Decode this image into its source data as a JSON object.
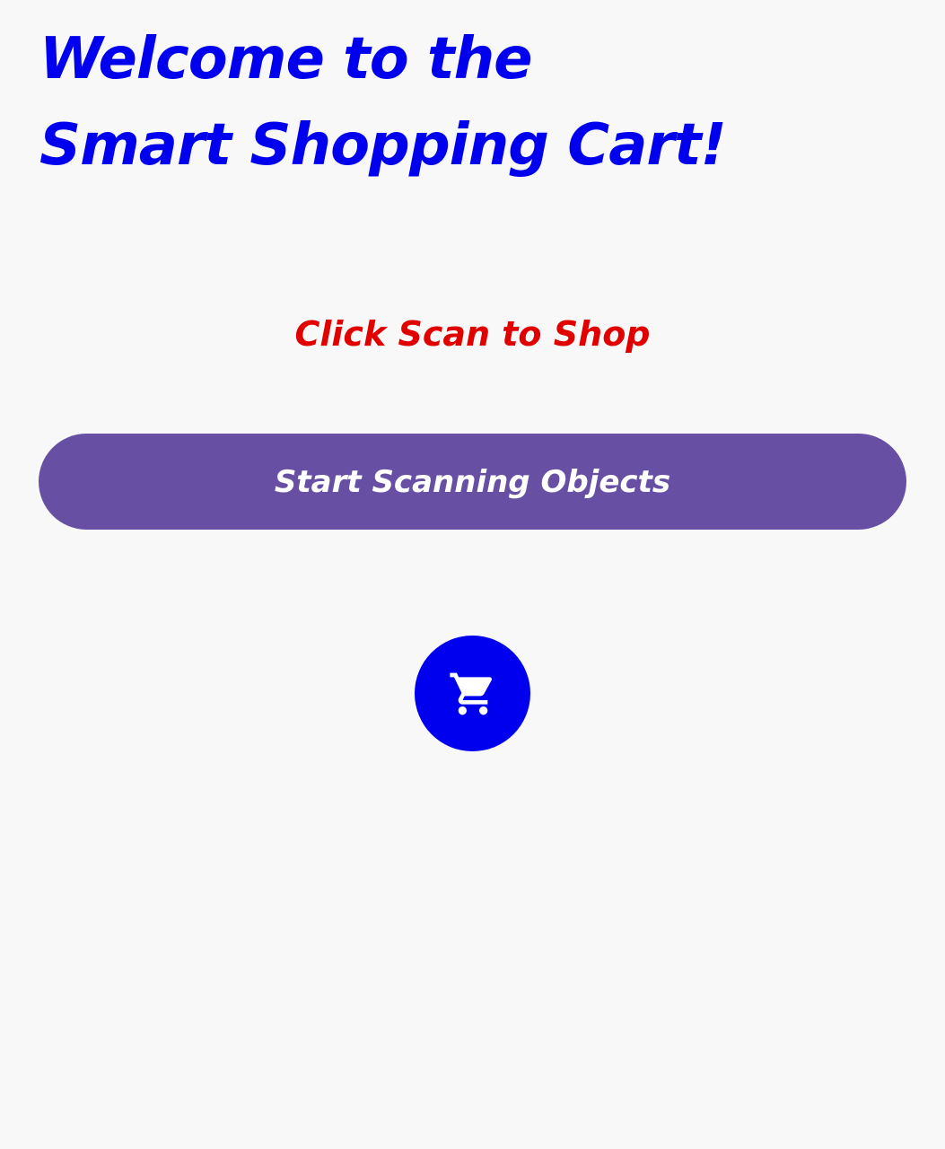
{
  "header": {
    "title": "Welcome to the Smart Shopping Cart!"
  },
  "main": {
    "subtitle": "Click Scan to Shop",
    "scan_button_label": "Start Scanning Objects",
    "cart_button_icon": "shopping-cart-icon"
  },
  "colors": {
    "title": "#0000ee",
    "subtitle": "#e00000",
    "button": "#6750a4",
    "fab": "#0000ee",
    "background": "#f8f8f8"
  }
}
